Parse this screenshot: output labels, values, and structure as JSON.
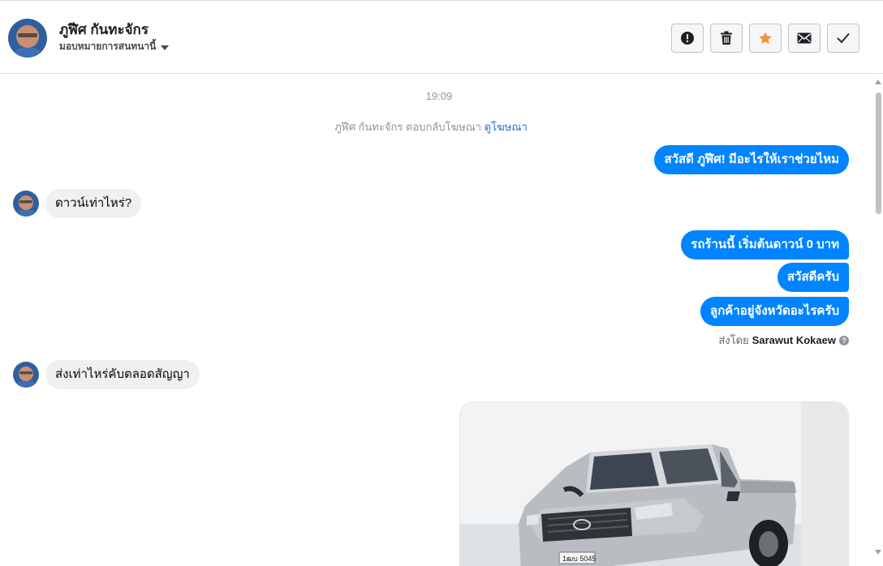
{
  "header": {
    "contact_name": "ภูฬีศ กันทะจักร",
    "assign_label": "มอบหมายการสนทนานี้",
    "actions": [
      {
        "icon": "alert-icon",
        "name": "mark-spam-button"
      },
      {
        "icon": "trash-icon",
        "name": "delete-button"
      },
      {
        "icon": "star-icon",
        "name": "star-button"
      },
      {
        "icon": "envelope-icon",
        "name": "mark-unread-button"
      },
      {
        "icon": "check-icon",
        "name": "mark-done-button"
      }
    ]
  },
  "thread": {
    "timestamp": "19:09",
    "reply_prefix": "ภูฬีศ กันทะจักร ตอบกลับโฆษณา",
    "reply_link": "ดูโฆษณา",
    "messages": {
      "out_1": "สวัสดี ภูฬีศ! มีอะไรให้เราช่วยไหม",
      "in_1": "ดาวน์เท่าไหร่?",
      "out_2": "รถร้านนี้ เริ่มต้นดาวน์ 0 บาท",
      "out_3": "สวัสดีครับ",
      "out_4": "ลูกค้าอยู่จังหวัดอะไรครับ",
      "in_2": "ส่งเท่าไหร่คับตลอดสัญญา"
    },
    "sent_by_prefix": "ส่งโดย",
    "sent_by_name": "Sarawut Kokaew",
    "plate_text": "1ฒบ 5045"
  },
  "colors": {
    "outgoing_bubble": "#0084ff",
    "incoming_bubble": "#f0f0f0",
    "star": "#f7923a",
    "link": "#216fdb"
  }
}
